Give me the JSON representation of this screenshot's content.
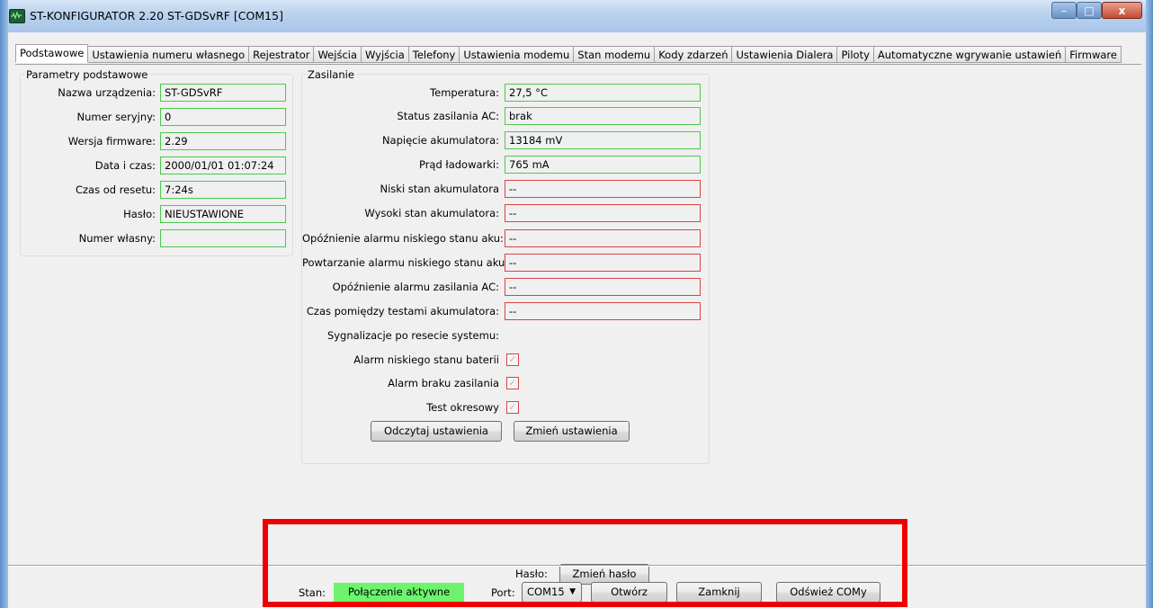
{
  "window": {
    "title": "ST-KONFIGURATOR 2.20 ST-GDSvRF  [COM15]",
    "controls": {
      "minimize": "–",
      "maximize": "□",
      "close": "x"
    }
  },
  "tabs": [
    "Podstawowe",
    "Ustawienia numeru własnego",
    "Rejestrator",
    "Wejścia",
    "Wyjścia",
    "Telefony",
    "Ustawienia modemu",
    "Stan modemu",
    "Kody zdarzeń",
    "Ustawienia Dialera",
    "Piloty",
    "Automatyczne wgrywanie ustawień",
    "Firmware"
  ],
  "basic": {
    "title": "Parametry podstawowe",
    "rows": [
      {
        "label": "Nazwa urządzenia:",
        "value": "ST-GDSvRF"
      },
      {
        "label": "Numer seryjny:",
        "value": "0"
      },
      {
        "label": "Wersja firmware:",
        "value": "2.29"
      },
      {
        "label": "Data i czas:",
        "value": "2000/01/01 01:07:24"
      },
      {
        "label": "Czas od resetu:",
        "value": "7:24s"
      },
      {
        "label": "Hasło:",
        "value": "NIEUSTAWIONE"
      },
      {
        "label": "Numer własny:",
        "value": ""
      }
    ]
  },
  "power": {
    "title": "Zasilanie",
    "rows": [
      {
        "label": "Temperatura:",
        "value": "27,5 °C",
        "status": "ok"
      },
      {
        "label": "Status zasilania AC:",
        "value": "brak",
        "status": "ok"
      },
      {
        "label": "Napięcie akumulatora:",
        "value": "13184 mV",
        "status": "ok"
      },
      {
        "label": "Prąd ładowarki:",
        "value": "765 mA",
        "status": "ok"
      },
      {
        "label": "Niski stan akumulatora",
        "value": "--",
        "status": "bad"
      },
      {
        "label": "Wysoki stan akumulatora:",
        "value": "--",
        "status": "bad"
      },
      {
        "label": "Opóźnienie alarmu niskiego stanu aku:",
        "value": "--",
        "status": "bad"
      },
      {
        "label": "Powtarzanie alarmu niskiego stanu aku:",
        "value": "--",
        "status": "bad"
      },
      {
        "label": "Opóźnienie alarmu zasilania AC:",
        "value": "--",
        "status": "bad"
      },
      {
        "label": "Czas pomiędzy testami akumulatora:",
        "value": "--",
        "status": "bad"
      }
    ],
    "signals_heading": "Sygnalizacje po resecie systemu:",
    "checks": [
      {
        "label": "Alarm niskiego stanu baterii",
        "checked": true
      },
      {
        "label": "Alarm braku zasilania",
        "checked": true
      },
      {
        "label": "Test okresowy",
        "checked": true
      }
    ],
    "read_button": "Odczytaj ustawienia",
    "change_button": "Zmień ustawienia"
  },
  "password": {
    "label": "Hasło:",
    "button": "Zmień hasło"
  },
  "status_bar": {
    "state_label": "Stan:",
    "state_value": "Połączenie aktywne",
    "port_label": "Port:",
    "port_value": "COM15",
    "open_button": "Otwórz",
    "close_button": "Zamknij",
    "refresh_button": "Odśwież COMy"
  },
  "colors": {
    "ok_border": "#4cc94c",
    "bad_border": "#d94444",
    "status_active": "#6cf56c",
    "highlight": "#ee0000"
  }
}
